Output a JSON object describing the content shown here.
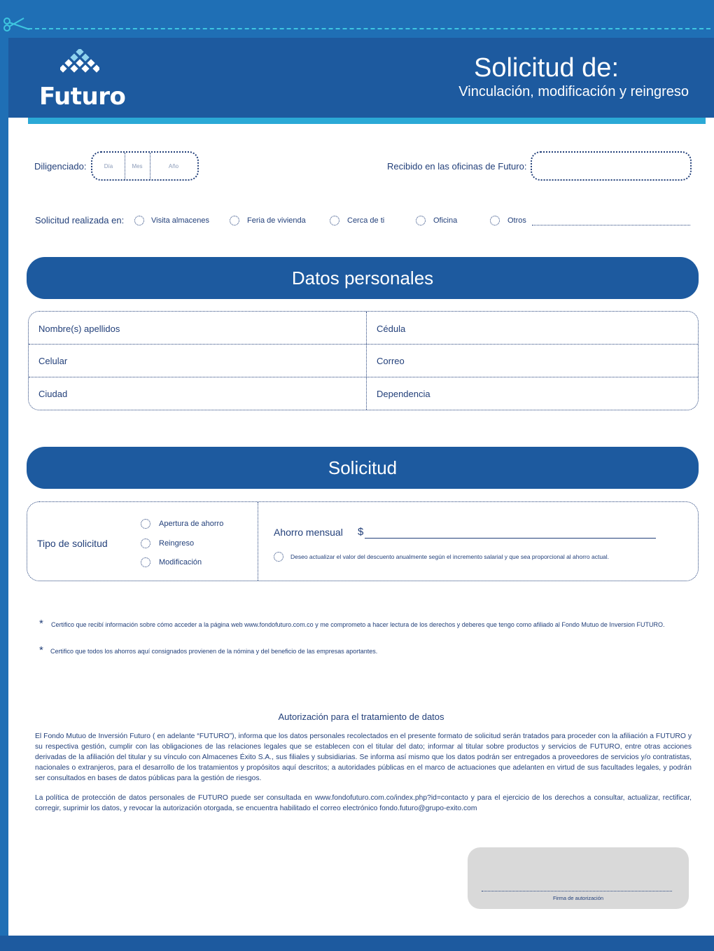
{
  "header": {
    "logo_text": "Futuro",
    "title": "Solicitud de:",
    "subtitle": "Vinculación, modificación y reingreso"
  },
  "form_top": {
    "diligenciado_label": "Diligenciado:",
    "date_day": "Día",
    "date_month": "Mes",
    "date_year": "Año",
    "recibido_label": "Recibido en las oficinas de Futuro:",
    "solicitud_en_label": "Solicitud realizada en:",
    "options": [
      "Visita almacenes",
      "Feria de vivienda",
      "Cerca de ti",
      "Oficina",
      "Otros"
    ]
  },
  "datos_personales": {
    "title": "Datos personales",
    "fields": [
      "Nombre(s) apellidos",
      "Cédula",
      "Celular",
      "Correo",
      "Ciudad",
      "Dependencia"
    ]
  },
  "solicitud": {
    "title": "Solicitud",
    "tipo_label": "Tipo de solicitud",
    "tipo_options": [
      "Apertura de ahorro",
      "Reingreso",
      "Modificación"
    ],
    "ahorro_label": "Ahorro mensual",
    "currency": "$",
    "checkbox_text": "Deseo actualizar el valor del descuento anualmente según el incremento salarial y que sea proporcional al ahorro actual."
  },
  "certificaciones": {
    "star": "*",
    "cert1": "Certifico que recibí información sobre cómo acceder a la página web www.fondofuturo.com.co y me comprometo a hacer lectura de los derechos y deberes que tengo como afiliado al Fondo Mutuo de Inversion FUTURO.",
    "cert2": "Certifico que todos los ahorros aquí consignados provienen de la nómina y del beneficio de las empresas aportantes."
  },
  "autorizacion": {
    "title": "Autorización para el tratamiento de datos",
    "p1": "El Fondo Mutuo de Inversión Futuro ( en adelante “FUTURO”), informa que los datos personales recolectados en el presente formato de solicitud serán tratados para proceder con la afiliación a FUTURO y su respectiva gestión, cumplir con las obligaciones de las relaciones legales que se establecen con el titular del dato; informar al titular sobre productos y servicios de FUTURO, entre otras acciones derivadas de la afiliación del titular y su vínculo con Almacenes Éxito S.A., sus filiales y subsidiarias. Se informa así mismo que los datos podrán ser entregados a proveedores de servicios y/o contratistas, nacionales o extranjeros, para el desarrollo de los tratamientos y propósitos aquí descritos; a autoridades públicas en el marco de actuaciones que adelanten en virtud de sus facultades legales, y podrán ser consultados en bases de datos públicas para la gestión de riesgos.",
    "p2": "La política de protección de datos personales de FUTURO puede ser consultada en www.fondofuturo.com.co/index.php?id=contacto y para el ejercicio de los derechos a consultar, actualizar, rectificar, corregir, suprimir los datos, y revocar la autorización otorgada, se encuentra habilitado el correo electrónico fondo.futuro@grupo-exito.com"
  },
  "firma": {
    "label": "Firma de autorización"
  },
  "colors": {
    "primary": "#1d5a9f",
    "accent": "#2ba9d6",
    "background": "#1f6fb5",
    "cutline": "#3ec6e0"
  },
  "icons": [
    "scissors-icon",
    "futuro-logo-icon"
  ]
}
